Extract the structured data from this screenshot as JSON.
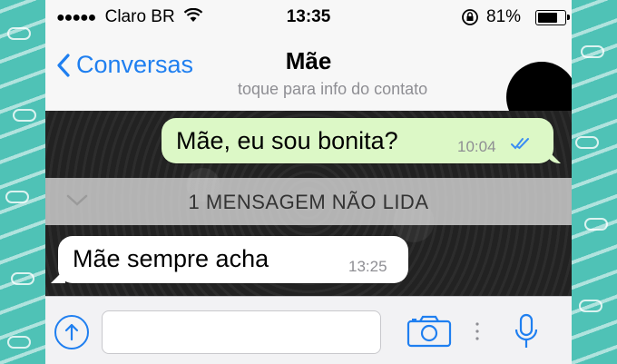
{
  "status_bar": {
    "signal_dots": "●●●●●",
    "carrier": "Claro BR",
    "time": "13:35",
    "battery_percent": "81%",
    "battery_level": 0.81
  },
  "nav": {
    "back_label": "Conversas",
    "contact_name": "Mãe",
    "contact_subtitle": "toque para info do contato"
  },
  "messages": [
    {
      "direction": "outgoing",
      "text": "Mãe, eu sou bonita?",
      "time": "10:04",
      "status": "read"
    },
    {
      "direction": "incoming",
      "text": "Mãe sempre acha",
      "time": "13:25"
    }
  ],
  "unread_banner": "1 MENSAGEM NÃO LIDA",
  "colors": {
    "accent": "#1f7ff0",
    "outgoing_bubble": "#dcf8c6",
    "incoming_bubble": "#ffffff",
    "side_pattern": "#4fc2b6"
  }
}
